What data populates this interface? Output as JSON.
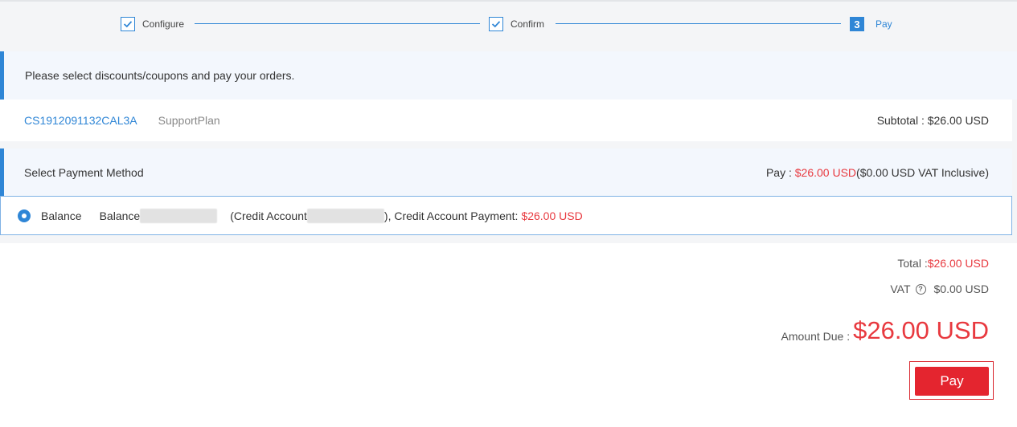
{
  "steps": [
    {
      "label": "Configure",
      "state": "done"
    },
    {
      "label": "Confirm",
      "state": "done"
    },
    {
      "label": "Pay",
      "number": "3",
      "state": "active"
    }
  ],
  "banner": {
    "text": "Please select discounts/coupons and pay your orders."
  },
  "order": {
    "id": "CS1912091132CAL3A",
    "product": "SupportPlan",
    "subtotal_label": "Subtotal : $26.00 USD"
  },
  "payment_method": {
    "title": "Select Payment Method",
    "pay_prefix": "Pay : ",
    "pay_amount": "$26.00 USD",
    "pay_vat": "($0.00 USD VAT Inclusive)"
  },
  "option": {
    "name": "Balance",
    "balance_label": "Balance",
    "credit_prefix": "(Credit Account",
    "credit_suffix": "), Credit Account Payment:",
    "credit_amount": "$26.00 USD",
    "selected": true
  },
  "summary": {
    "total_label": "Total :",
    "total_value": "$26.00 USD",
    "vat_label": "VAT",
    "vat_value": "$0.00 USD",
    "amount_due_label": "Amount Due :",
    "amount_due_value": "$26.00 USD"
  },
  "actions": {
    "pay_label": "Pay"
  },
  "colors": {
    "accent": "#2f86d6",
    "danger": "#e8393f",
    "page_bg": "#f4f5f7"
  },
  "icons": {
    "step_done": "checkbox-checked-icon",
    "radio": "radio-selected-icon",
    "vat_help": "question-circle-icon"
  }
}
